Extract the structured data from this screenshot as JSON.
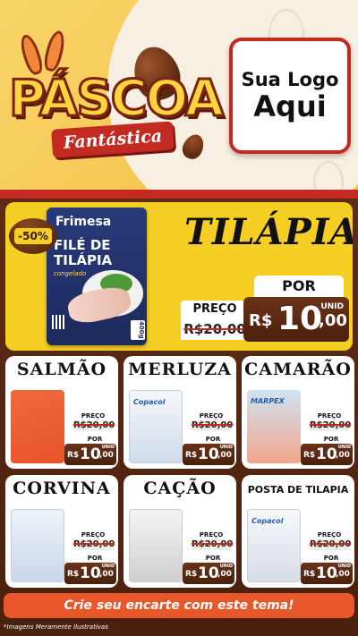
{
  "header": {
    "title_main": "PÁSCOA",
    "title_ribbon": "Fantástica",
    "logo_line1": "Sua Logo",
    "logo_line2": "Aqui"
  },
  "featured": {
    "badge": "-50%",
    "brand": "Frimesa",
    "package_name": "FILÉ DE TILÁPIA",
    "package_sub": "congelado",
    "package_weight": "400g",
    "title": "TILÁPIA",
    "preco_label": "PREÇO",
    "old_price": "R$20,00",
    "por_label": "POR",
    "currency": "R$",
    "price_int": "10",
    "price_dec": ",00",
    "unit": "UNID"
  },
  "products": [
    {
      "name": "SALMÃO",
      "preco_label": "PREÇO",
      "old_price": "R$20,00",
      "por_label": "POR",
      "currency": "R$",
      "price_int": "10",
      "price_dec": ",00",
      "unit": "UNID"
    },
    {
      "name": "MERLUZA",
      "preco_label": "PREÇO",
      "old_price": "R$20,00",
      "por_label": "POR",
      "currency": "R$",
      "price_int": "10",
      "price_dec": ",00",
      "unit": "UNID"
    },
    {
      "name": "CAMARÃO",
      "preco_label": "PREÇO",
      "old_price": "R$20,00",
      "por_label": "POR",
      "currency": "R$",
      "price_int": "10",
      "price_dec": ",00",
      "unit": "UNID"
    },
    {
      "name": "CORVINA",
      "preco_label": "PREÇO",
      "old_price": "R$20,00",
      "por_label": "POR",
      "currency": "R$",
      "price_int": "10",
      "price_dec": ",00",
      "unit": "UNID"
    },
    {
      "name": "CAÇÃO",
      "preco_label": "PREÇO",
      "old_price": "R$20,00",
      "por_label": "POR",
      "currency": "R$",
      "price_int": "10",
      "price_dec": ",00",
      "unit": "UNID"
    },
    {
      "name": "POSTA DE TILAPIA",
      "preco_label": "PREÇO",
      "old_price": "R$20,00",
      "por_label": "POR",
      "currency": "R$",
      "price_int": "10",
      "price_dec": ",00",
      "unit": "UNID"
    }
  ],
  "product_labels": {
    "merluza_brand": "Copacol",
    "camarao_brand": "MARPEX",
    "posta_brand": "Copacol"
  },
  "cta": "Crie seu encarte com este tema!",
  "disclaimer": "*Imagens Meramente Ilustrativas",
  "colors": {
    "header_yellow": "#f4c14a",
    "accent_red": "#c22a22",
    "chocolate": "#4a200c",
    "featured_yellow": "#f5cf24",
    "cta_orange": "#e8572a"
  }
}
